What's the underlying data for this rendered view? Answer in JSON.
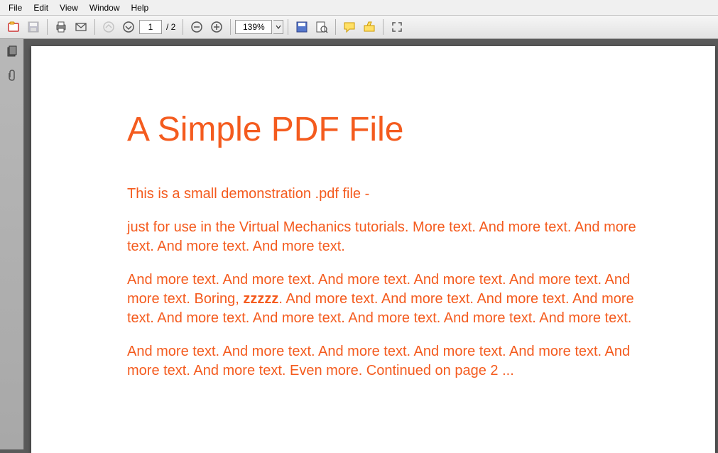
{
  "menu": {
    "file": "File",
    "edit": "Edit",
    "view": "View",
    "window": "Window",
    "help": "Help"
  },
  "toolbar": {
    "page_current": "1",
    "page_total": "/ 2",
    "zoom": "139%"
  },
  "pdf": {
    "title": "A Simple PDF File",
    "p1": "This is a small demonstration .pdf file -",
    "p2": "just for use in the Virtual Mechanics tutorials. More text. And more text. And more text. And more text. And more text.",
    "p3a": "And more text. And more text. And more text. And more text. And more text. And more text. Boring, ",
    "p3b": "zzzzz",
    "p3c": ". And more text. And more text. And more text. And more text. And more text. And more text. And more text. And more text. And more text.",
    "p4": "And more text. And more text. And more text. And more text. And more text. And more text. And more text. Even more. Continued on page 2 ..."
  }
}
